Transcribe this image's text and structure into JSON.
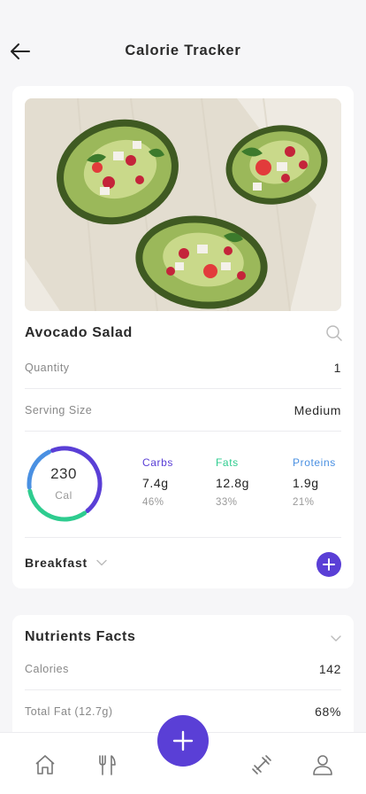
{
  "header": {
    "title": "Calorie Tracker"
  },
  "food": {
    "name": "Avocado Salad",
    "quantity_label": "Quantity",
    "quantity_value": "1",
    "serving_label": "Serving Size",
    "serving_value": "Medium"
  },
  "calories": {
    "value": "230",
    "unit": "Cal"
  },
  "macros": [
    {
      "name": "Carbs",
      "amount": "7.4g",
      "percent": "46%",
      "color": "#5a3fd6"
    },
    {
      "name": "Fats",
      "amount": "12.8g",
      "percent": "33%",
      "color": "#2ecc8f"
    },
    {
      "name": "Proteins",
      "amount": "1.9g",
      "percent": "21%",
      "color": "#4a90e2"
    }
  ],
  "meal": {
    "selected": "Breakfast"
  },
  "nutrients": {
    "title": "Nutrients Facts",
    "rows": [
      {
        "label": "Calories",
        "value": "142"
      },
      {
        "label": "Total Fat (12.7g)",
        "value": "68%"
      }
    ]
  },
  "nav": {
    "items": [
      "home-icon",
      "utensils-icon",
      "plus-icon",
      "dumbbell-icon",
      "profile-icon"
    ]
  },
  "colors": {
    "accent": "#5a3fd6",
    "green": "#2ecc8f",
    "blue": "#4a90e2"
  }
}
